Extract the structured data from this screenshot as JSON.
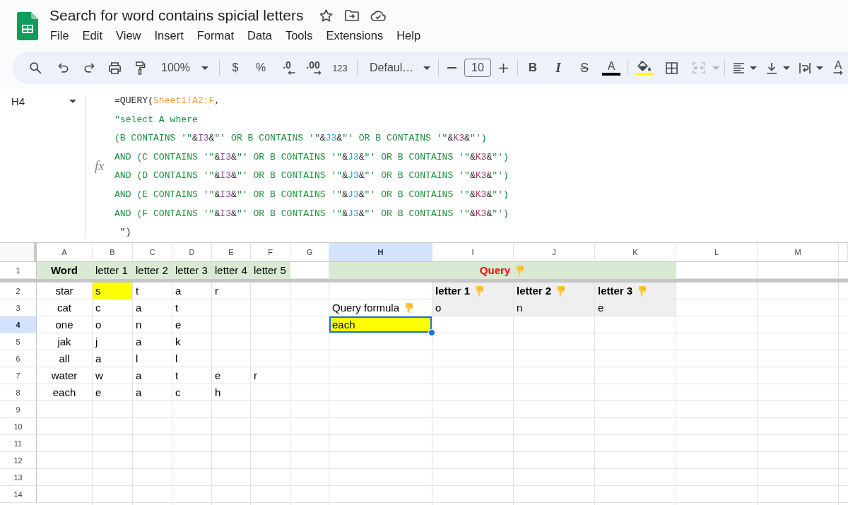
{
  "app_bar": {
    "doc_title": "Search for word contains spicial letters",
    "menu": [
      "File",
      "Edit",
      "View",
      "Insert",
      "Format",
      "Data",
      "Tools",
      "Extensions",
      "Help"
    ]
  },
  "toolbar": {
    "zoom": "100%",
    "currency": "$",
    "percent": "%",
    "decrease_decimals": ".0",
    "increase_decimals": ".00",
    "number_format": "123",
    "font": "Defaul…",
    "font_size": "10",
    "bold": "B",
    "italic": "I",
    "strikethrough": "S",
    "text_color": {
      "label": "A",
      "color": "#000000"
    },
    "fill_color": {
      "color": "#ffff00"
    },
    "merge": {
      "disabled": true
    },
    "text_rotation": "A"
  },
  "formula_bar": {
    "cell_ref": "H4",
    "function_label": "fx",
    "lines": [
      [
        {
          "kind": "plain",
          "text": "=QUERY("
        },
        {
          "kind": "ref",
          "text": "Sheet1!A2:F",
          "color": "#f29b3c"
        },
        {
          "kind": "plain",
          "text": ","
        }
      ],
      [
        {
          "kind": "literal",
          "text": "\"select A where"
        }
      ],
      [
        {
          "kind": "literal",
          "text": "(B CONTAINS '\""
        },
        {
          "kind": "plain",
          "text": "&"
        },
        {
          "kind": "ref",
          "text": "I3",
          "color": "#8b3fa4"
        },
        {
          "kind": "plain",
          "text": "&"
        },
        {
          "kind": "literal",
          "text": "\"' OR B CONTAINS '\""
        },
        {
          "kind": "plain",
          "text": "&"
        },
        {
          "kind": "ref",
          "text": "J3",
          "color": "#2aa3d6"
        },
        {
          "kind": "plain",
          "text": "&"
        },
        {
          "kind": "literal",
          "text": "\"' OR B CONTAINS '\""
        },
        {
          "kind": "plain",
          "text": "&"
        },
        {
          "kind": "ref",
          "text": "K3",
          "color": "#a8325e"
        },
        {
          "kind": "plain",
          "text": "&"
        },
        {
          "kind": "literal",
          "text": "\"')"
        }
      ],
      [
        {
          "kind": "literal",
          "text": "AND (C CONTAINS '\""
        },
        {
          "kind": "plain",
          "text": "&"
        },
        {
          "kind": "ref",
          "text": "I3",
          "color": "#8b3fa4"
        },
        {
          "kind": "plain",
          "text": "&"
        },
        {
          "kind": "literal",
          "text": "\"' OR B CONTAINS '\""
        },
        {
          "kind": "plain",
          "text": "&"
        },
        {
          "kind": "ref",
          "text": "J3",
          "color": "#2aa3d6"
        },
        {
          "kind": "plain",
          "text": "&"
        },
        {
          "kind": "literal",
          "text": "\"' OR B CONTAINS '\""
        },
        {
          "kind": "plain",
          "text": "&"
        },
        {
          "kind": "ref",
          "text": "K3",
          "color": "#a8325e"
        },
        {
          "kind": "plain",
          "text": "&"
        },
        {
          "kind": "literal",
          "text": "\"')"
        }
      ],
      [
        {
          "kind": "literal",
          "text": "AND (D CONTAINS '\""
        },
        {
          "kind": "plain",
          "text": "&"
        },
        {
          "kind": "ref",
          "text": "I3",
          "color": "#8b3fa4"
        },
        {
          "kind": "plain",
          "text": "&"
        },
        {
          "kind": "literal",
          "text": "\"' OR B CONTAINS '\""
        },
        {
          "kind": "plain",
          "text": "&"
        },
        {
          "kind": "ref",
          "text": "J3",
          "color": "#2aa3d6"
        },
        {
          "kind": "plain",
          "text": "&"
        },
        {
          "kind": "literal",
          "text": "\"' OR B CONTAINS '\""
        },
        {
          "kind": "plain",
          "text": "&"
        },
        {
          "kind": "ref",
          "text": "K3",
          "color": "#a8325e"
        },
        {
          "kind": "plain",
          "text": "&"
        },
        {
          "kind": "literal",
          "text": "\"')"
        }
      ],
      [
        {
          "kind": "literal",
          "text": "AND (E CONTAINS '\""
        },
        {
          "kind": "plain",
          "text": "&"
        },
        {
          "kind": "ref",
          "text": "I3",
          "color": "#8b3fa4"
        },
        {
          "kind": "plain",
          "text": "&"
        },
        {
          "kind": "literal",
          "text": "\"' OR B CONTAINS '\""
        },
        {
          "kind": "plain",
          "text": "&"
        },
        {
          "kind": "ref",
          "text": "J3",
          "color": "#2aa3d6"
        },
        {
          "kind": "plain",
          "text": "&"
        },
        {
          "kind": "literal",
          "text": "\"' OR B CONTAINS '\""
        },
        {
          "kind": "plain",
          "text": "&"
        },
        {
          "kind": "ref",
          "text": "K3",
          "color": "#a8325e"
        },
        {
          "kind": "plain",
          "text": "&"
        },
        {
          "kind": "literal",
          "text": "\"')"
        }
      ],
      [
        {
          "kind": "literal",
          "text": "AND (F CONTAINS '\""
        },
        {
          "kind": "plain",
          "text": "&"
        },
        {
          "kind": "ref",
          "text": "I3",
          "color": "#8b3fa4"
        },
        {
          "kind": "plain",
          "text": "&"
        },
        {
          "kind": "literal",
          "text": "\"' OR B CONTAINS '\""
        },
        {
          "kind": "plain",
          "text": "&"
        },
        {
          "kind": "ref",
          "text": "J3",
          "color": "#2aa3d6"
        },
        {
          "kind": "plain",
          "text": "&"
        },
        {
          "kind": "literal",
          "text": "\"' OR B CONTAINS '\""
        },
        {
          "kind": "plain",
          "text": "&"
        },
        {
          "kind": "ref",
          "text": "K3",
          "color": "#a8325e"
        },
        {
          "kind": "plain",
          "text": "&"
        },
        {
          "kind": "literal",
          "text": "\"')"
        }
      ],
      [
        {
          "kind": "plain",
          "text": " \")"
        }
      ]
    ]
  },
  "grid": {
    "columns": [
      {
        "label": "A",
        "selected": false
      },
      {
        "label": "B",
        "selected": false
      },
      {
        "label": "C",
        "selected": false
      },
      {
        "label": "D",
        "selected": false
      },
      {
        "label": "E",
        "selected": false
      },
      {
        "label": "F",
        "selected": false
      },
      {
        "label": "G",
        "selected": false
      },
      {
        "label": "H",
        "selected": true
      },
      {
        "label": "I",
        "selected": false
      },
      {
        "label": "J",
        "selected": false
      },
      {
        "label": "K",
        "selected": false
      },
      {
        "label": "L",
        "selected": false
      },
      {
        "label": "M",
        "selected": false
      }
    ],
    "frozen_rows": [
      {
        "number": "1",
        "selected": false,
        "cells": [
          {
            "text": "Word",
            "kind": "heading",
            "color": "#d9ead3"
          },
          {
            "text": "letter 1",
            "kind": "text",
            "color": "#d9ead3"
          },
          {
            "text": "letter 2",
            "kind": "text",
            "color": "#d9ead3"
          },
          {
            "text": "letter 3",
            "kind": "text",
            "color": "#d9ead3"
          },
          {
            "text": "letter 4",
            "kind": "text",
            "color": "#d9ead3"
          },
          {
            "text": "letter 5",
            "kind": "text",
            "color": "#d9ead3"
          },
          null,
          {
            "text": "Query",
            "kind": "title",
            "color": "#d9ead3",
            "emoji_icon": true
          }
        ]
      }
    ],
    "rows": [
      {
        "number": "2",
        "selected": false,
        "cells": [
          {
            "text": "star",
            "kind": "centered"
          },
          {
            "text": "s",
            "kind": "text",
            "color": "#ffff00"
          },
          {
            "text": "t",
            "kind": "text"
          },
          {
            "text": "a",
            "kind": "text"
          },
          {
            "text": "r",
            "kind": "text"
          },
          null,
          null,
          null,
          {
            "text": "letter 1",
            "kind": "label",
            "color": "#efefef",
            "emoji_icon": true
          },
          {
            "text": "letter 2",
            "kind": "label",
            "color": "#efefef",
            "emoji_icon": true
          },
          {
            "text": "letter 3",
            "kind": "label",
            "color": "#efefef",
            "emoji_icon": true
          }
        ]
      },
      {
        "number": "3",
        "selected": false,
        "cells": [
          {
            "text": "cat",
            "kind": "centered"
          },
          {
            "text": "c",
            "kind": "text"
          },
          {
            "text": "a",
            "kind": "text"
          },
          {
            "text": "t",
            "kind": "text"
          },
          null,
          null,
          null,
          {
            "text": "Query formula",
            "kind": "text",
            "emoji_icon": true
          },
          {
            "text": "o",
            "kind": "text",
            "color": "#efefef"
          },
          {
            "text": "n",
            "kind": "text",
            "color": "#efefef"
          },
          {
            "text": "e",
            "kind": "text",
            "color": "#efefef"
          }
        ]
      },
      {
        "number": "4",
        "selected": true,
        "cells": [
          {
            "text": "one",
            "kind": "centered"
          },
          {
            "text": "o",
            "kind": "text"
          },
          {
            "text": "n",
            "kind": "text"
          },
          {
            "text": "e",
            "kind": "text"
          },
          null,
          null,
          null,
          {
            "text": "each",
            "kind": "text",
            "color": "#ffff00"
          }
        ]
      },
      {
        "number": "5",
        "selected": false,
        "cells": [
          {
            "text": "jak",
            "kind": "centered"
          },
          {
            "text": "j",
            "kind": "text"
          },
          {
            "text": "a",
            "kind": "text"
          },
          {
            "text": "k",
            "kind": "text"
          }
        ]
      },
      {
        "number": "6",
        "selected": false,
        "cells": [
          {
            "text": "all",
            "kind": "centered"
          },
          {
            "text": "a",
            "kind": "text"
          },
          {
            "text": "l",
            "kind": "text"
          },
          {
            "text": "l",
            "kind": "text"
          }
        ]
      },
      {
        "number": "7",
        "selected": false,
        "cells": [
          {
            "text": "water",
            "kind": "centered"
          },
          {
            "text": "w",
            "kind": "text"
          },
          {
            "text": "a",
            "kind": "text"
          },
          {
            "text": "t",
            "kind": "text"
          },
          {
            "text": "e",
            "kind": "text"
          },
          {
            "text": "r",
            "kind": "text"
          }
        ]
      },
      {
        "number": "8",
        "selected": false,
        "cells": [
          {
            "text": "each",
            "kind": "centered"
          },
          {
            "text": "e",
            "kind": "text"
          },
          {
            "text": "a",
            "kind": "text"
          },
          {
            "text": "c",
            "kind": "text"
          },
          {
            "text": "h",
            "kind": "text"
          }
        ]
      },
      {
        "number": "9",
        "selected": false
      },
      {
        "number": "10",
        "selected": false
      },
      {
        "number": "11",
        "selected": false
      },
      {
        "number": "12",
        "selected": false
      },
      {
        "number": "13",
        "selected": false
      },
      {
        "number": "14",
        "selected": false
      }
    ]
  }
}
